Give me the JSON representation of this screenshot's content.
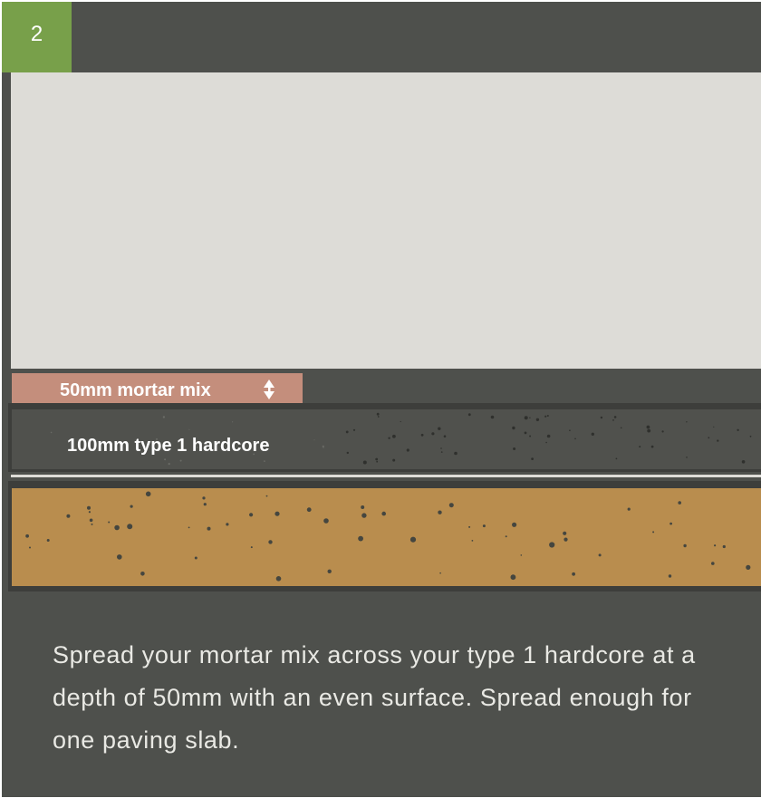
{
  "step": {
    "number": "2"
  },
  "colors": {
    "frame": "#4e504c",
    "badge": "#78a04a",
    "sky": "#dddcd7",
    "mortar": "#c48e7c",
    "hardcore": "#4f504c",
    "soil": "#b98d4e",
    "stone": "#45463f"
  },
  "layers": {
    "mortar": {
      "label": "50mm mortar mix"
    },
    "hardcore": {
      "label": "100mm type 1 hardcore"
    }
  },
  "icons": {
    "depth": "up-down-arrow-icon"
  },
  "caption": "Spread your mortar mix across your type 1 hardcore at a depth of 50mm with an even surface. Spread enough for one paving slab."
}
